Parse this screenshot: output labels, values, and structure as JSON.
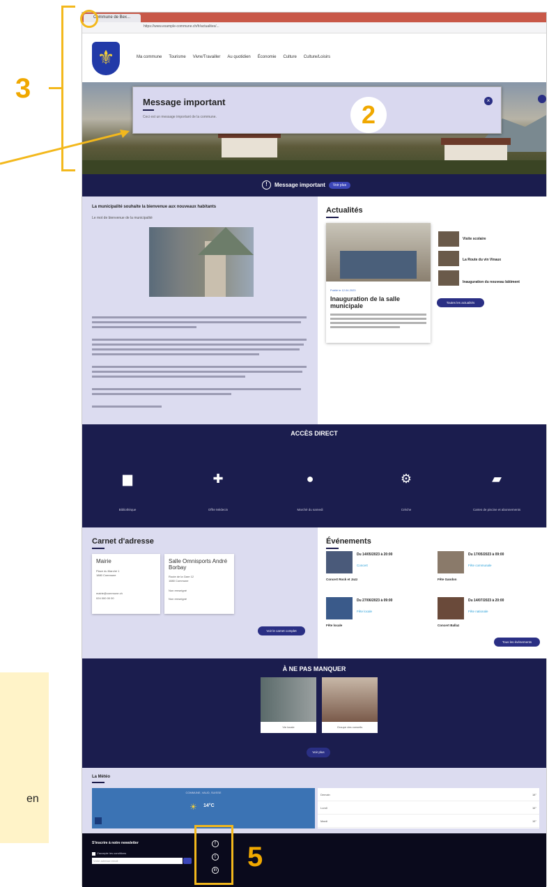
{
  "annotations": {
    "label_3": "3",
    "label_2": "2",
    "label_5": "5",
    "side_note": "en"
  },
  "browser": {
    "tab_title": "Commune de Bex...",
    "url": "https://www.example-commune.ch/fr/actualites/..."
  },
  "header": {
    "nav": [
      "Ma commune",
      "Tourisme",
      "Vivre/Travailler",
      "Au quotidien",
      "Économie",
      "Culture",
      "Culture/Loisirs"
    ]
  },
  "modal": {
    "title": "Message important",
    "text": "Ceci est un message important de la commune."
  },
  "message_band": {
    "text": "Message important",
    "button": "Voir plus"
  },
  "article": {
    "title": "La municipalité souhaite la bienvenue aux nouveaux habitants",
    "subtitle": "Le mot de bienvenue de la municipalité"
  },
  "news": {
    "section_title": "Actualités",
    "main_date": "Publié le 12.04.2023",
    "main_title": "Inauguration de la salle municipale",
    "side": [
      "Visite scolaire",
      "La Route du vin Vinaux",
      "Inauguration du nouveau bâtiment"
    ],
    "all_button": "Toutes les actualités"
  },
  "acces_direct": {
    "title": "ACCÈS DIRECT",
    "items": [
      {
        "icon": "book-icon",
        "glyph": "▆",
        "label": "Bibliothèque"
      },
      {
        "icon": "medical-kit-icon",
        "glyph": "✚",
        "label": "Offre Médecin"
      },
      {
        "icon": "shopping-bag-icon",
        "glyph": "●",
        "label": "Marché du samedi"
      },
      {
        "icon": "gears-icon",
        "glyph": "⚙",
        "label": "Crèche"
      },
      {
        "icon": "open-book-icon",
        "glyph": "▰",
        "label": "Cartes de piscine et abonnements"
      }
    ]
  },
  "carnet": {
    "title": "Carnet d'adresse",
    "cards": [
      {
        "name": "Mairie",
        "lines": [
          "Place du Marché 1",
          "1880 Commune",
          "mairie@commune.ch",
          "024 000 00 00"
        ]
      },
      {
        "name": "Salle Omnisports André Borbay",
        "lines": [
          "Route de la Gare 12",
          "1880 Commune",
          "Non renseigné",
          "Non renseigné"
        ]
      }
    ],
    "button": "Voir le carnet complet"
  },
  "events": {
    "title": "Événements",
    "items": [
      {
        "date": "Du 14/05/2023 à 20:00",
        "category": "Concert",
        "name": "Concert Rock et Jazz"
      },
      {
        "date": "Du 17/05/2023 à 09:00",
        "category": "Fête communale",
        "name": "Fête Gandon"
      },
      {
        "date": "Du 27/06/2023 à 09:00",
        "category": "Fête locale",
        "name": "Fête locale"
      },
      {
        "date": "Du 14/07/2023 à 20:00",
        "category": "Fête nationale",
        "name": "Concert Ballaz"
      }
    ],
    "button": "Tous les événements"
  },
  "anpm": {
    "title": "À NE PAS MANQUER",
    "cards": [
      "Vie locale",
      "Groupe des conseils"
    ],
    "button": "Voir plus"
  },
  "meteo": {
    "title": "La Météo",
    "location": "COMMUNE, VAUD, SUISSE",
    "temperature": "14°C",
    "rows": [
      {
        "day": "Demain",
        "value": "18°"
      },
      {
        "day": "Lundi",
        "value": "16°"
      },
      {
        "day": "Mardi",
        "value": "15°"
      }
    ]
  },
  "footer": {
    "newsletter_title": "S'inscrire à notre newsletter",
    "checkbox_label": "J'accepte les conditions",
    "input_placeholder": "Votre adresse email",
    "social": [
      "facebook-icon",
      "twitter-icon",
      "linkedin-icon"
    ]
  },
  "colors": {
    "accent": "#f3b81c",
    "navy": "#1b1d4e",
    "lavender": "#dcdcf0",
    "button": "#2a2f84"
  }
}
